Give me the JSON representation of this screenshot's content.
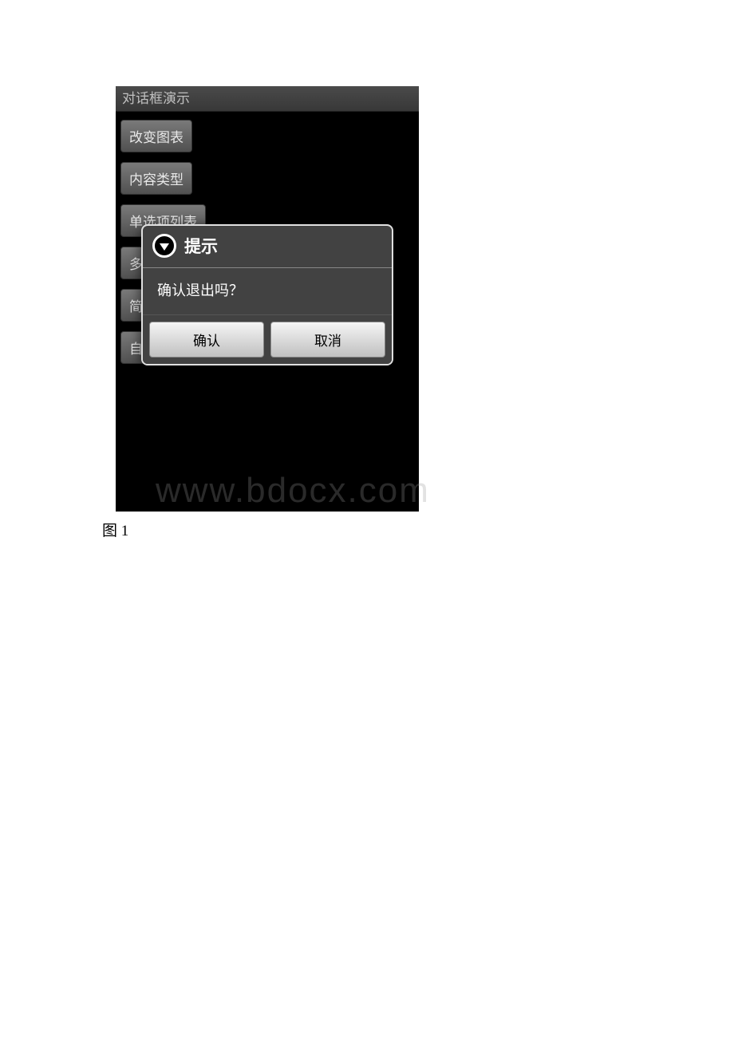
{
  "app": {
    "title": "对话框演示"
  },
  "buttons": {
    "b0": "改变图表",
    "b1": "内容类型",
    "b2": "单选项列表",
    "b3": "多",
    "b4": "简",
    "b5": "自"
  },
  "dialog": {
    "title": "提示",
    "message": "确认退出吗？",
    "confirm": "确认",
    "cancel": "取消"
  },
  "watermark": "www.bdocx.com",
  "caption": "图 1"
}
